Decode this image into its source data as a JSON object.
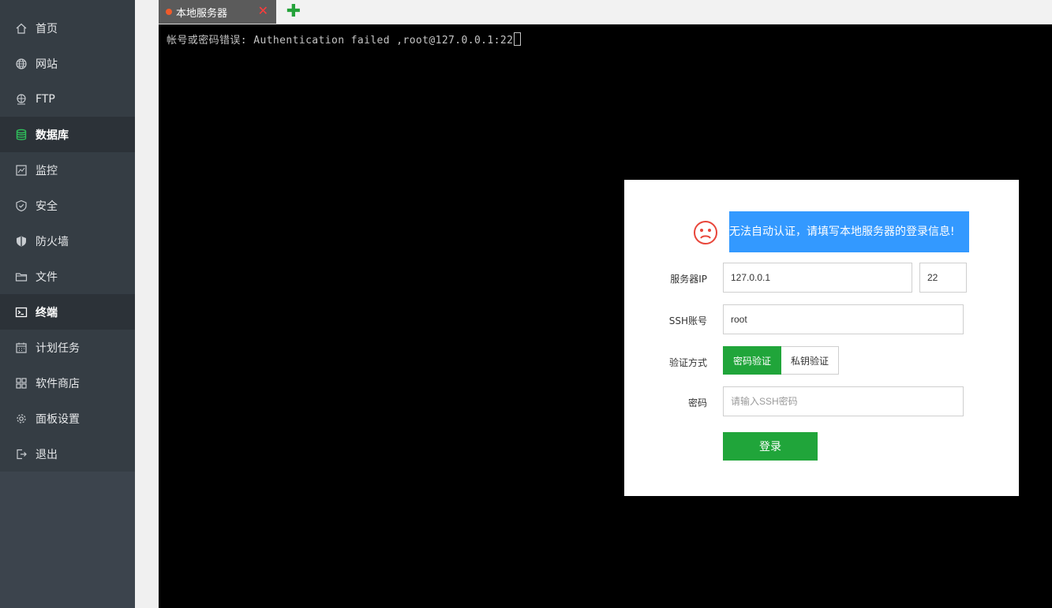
{
  "sidebar": {
    "items": [
      {
        "label": "首页",
        "icon": "home-icon"
      },
      {
        "label": "网站",
        "icon": "globe-icon"
      },
      {
        "label": "FTP",
        "icon": "ftp-icon"
      },
      {
        "label": "数据库",
        "icon": "database-icon"
      },
      {
        "label": "监控",
        "icon": "monitor-icon"
      },
      {
        "label": "安全",
        "icon": "shield-icon"
      },
      {
        "label": "防火墙",
        "icon": "firewall-icon"
      },
      {
        "label": "文件",
        "icon": "folder-icon"
      },
      {
        "label": "终端",
        "icon": "terminal-icon"
      },
      {
        "label": "计划任务",
        "icon": "calendar-icon"
      },
      {
        "label": "软件商店",
        "icon": "grid-icon"
      },
      {
        "label": "面板设置",
        "icon": "gear-icon"
      },
      {
        "label": "退出",
        "icon": "logout-icon"
      }
    ]
  },
  "tabs": {
    "active_label": "本地服务器",
    "close_glyph": "✕",
    "add_glyph": "✚"
  },
  "terminal": {
    "line": "帐号或密码错误: Authentication failed ,root@127.0.0.1:22"
  },
  "modal": {
    "message": "无法自动认证，请填写本地服务器的登录信息!",
    "ip_label": "服务器IP",
    "ip_value": "127.0.0.1",
    "port_value": "22",
    "ssh_label": "SSH账号",
    "ssh_value": "root",
    "auth_label": "验证方式",
    "auth_password": "密码验证",
    "auth_key": "私钥验证",
    "password_label": "密码",
    "password_placeholder": "请输入SSH密码",
    "login_button": "登录"
  },
  "colors": {
    "sidebar_bg": "#353d44",
    "accent_green": "#20a53a",
    "message_bg": "#3399ff",
    "sad_face": "#e8463a"
  }
}
